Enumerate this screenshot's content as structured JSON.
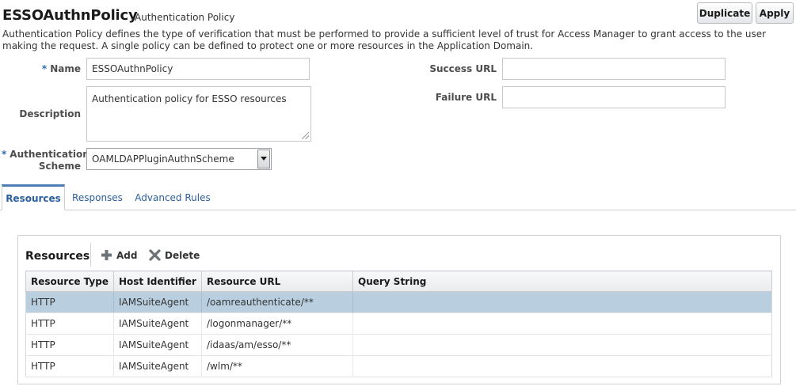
{
  "header": {
    "title": "ESSOAuthnPolicy",
    "subtitle": "Authentication Policy",
    "duplicate_label": "Duplicate",
    "apply_label": "Apply"
  },
  "description_text": "Authentication Policy defines the type of verification that must be performed to provide a sufficient level of trust for Access Manager to grant access to the user making the request. A single policy can be defined to protect one or more resources in the Application Domain.",
  "form": {
    "required_mark": "*",
    "name_label": "Name",
    "name_value": "ESSOAuthnPolicy",
    "description_label": "Description",
    "description_value": "Authentication policy for ESSO resources",
    "scheme_label_line1": "Authentication",
    "scheme_label_line2": "Scheme",
    "scheme_value": "OAMLDAPPluginAuthnScheme",
    "success_url_label": "Success URL",
    "success_url_value": "",
    "failure_url_label": "Failure URL",
    "failure_url_value": ""
  },
  "tabs": [
    {
      "label": "Resources",
      "active": true
    },
    {
      "label": "Responses",
      "active": false
    },
    {
      "label": "Advanced Rules",
      "active": false
    }
  ],
  "resources": {
    "title": "Resources",
    "add_label": "Add",
    "delete_label": "Delete",
    "columns": [
      "Resource Type",
      "Host Identifier",
      "Resource URL",
      "Query String"
    ],
    "rows": [
      {
        "type": "HTTP",
        "host": "IAMSuiteAgent",
        "url": "/oamreauthenticate/**",
        "query": "",
        "selected": true
      },
      {
        "type": "HTTP",
        "host": "IAMSuiteAgent",
        "url": "/logonmanager/**",
        "query": "",
        "selected": false
      },
      {
        "type": "HTTP",
        "host": "IAMSuiteAgent",
        "url": "/idaas/am/esso/**",
        "query": "",
        "selected": false
      },
      {
        "type": "HTTP",
        "host": "IAMSuiteAgent",
        "url": "/wlm/**",
        "query": "",
        "selected": false
      }
    ]
  },
  "icons": {
    "add": "plus-icon",
    "delete": "x-icon",
    "dropdown": "triangle-down-icon"
  },
  "colors": {
    "accent": "#2b5f9e",
    "selected_row": "#b9cfe0",
    "required_star": "#2b6db3"
  }
}
